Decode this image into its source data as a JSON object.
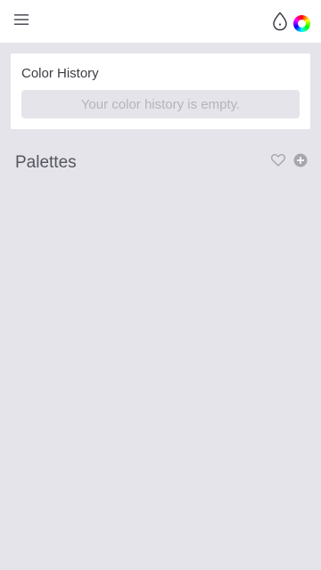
{
  "header": {
    "menu_icon": "menu-icon",
    "eyedropper_icon": "eyedropper-icon",
    "color_wheel_icon": "color-wheel-icon"
  },
  "color_history": {
    "title": "Color History",
    "empty_message": "Your color history is empty."
  },
  "palettes": {
    "title": "Palettes",
    "favorite_icon": "heart-icon",
    "add_icon": "add-circle-icon"
  },
  "colors": {
    "background": "#e4e4ea",
    "surface": "#ffffff",
    "text_primary": "#3c3c44",
    "text_muted": "#b4b4bc",
    "icon_gray": "#a6a6ae"
  }
}
